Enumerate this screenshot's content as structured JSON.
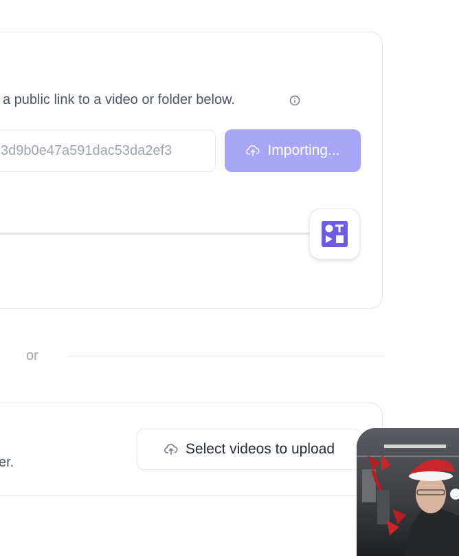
{
  "import_section": {
    "description": "a public link to a video or folder below.",
    "url_value": "3d9b0e47a591dac53da2ef3",
    "import_button_label": "Importing..."
  },
  "separator": {
    "or_label": "or"
  },
  "upload_section": {
    "truncated_text": "er.",
    "upload_button_label": "Select videos to upload"
  },
  "colors": {
    "accent": "#a8a4f6",
    "logo": "#6d5ae6",
    "border": "#e5e7eb"
  },
  "icons": {
    "info": "info-icon",
    "upload": "cloud-upload-icon",
    "logo": "shapes-logo-icon"
  }
}
